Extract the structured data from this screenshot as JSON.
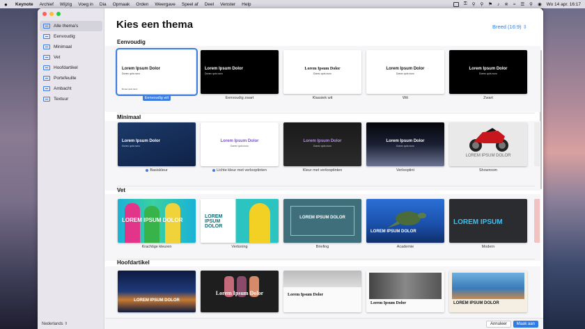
{
  "menubar": {
    "app": "Keynote",
    "items": [
      "Archief",
      "Wijzig",
      "Voeg in",
      "Dia",
      "Opmaak",
      "Orden",
      "Weergave",
      "Speel af",
      "Deel",
      "Venster",
      "Help"
    ],
    "datetime": "Wo 14 apr. 16:17"
  },
  "sidebar": {
    "items": [
      {
        "label": "Alle thema's"
      },
      {
        "label": "Eenvoudig"
      },
      {
        "label": "Minimaal"
      },
      {
        "label": "Vet"
      },
      {
        "label": "Hoofdartikel"
      },
      {
        "label": "Portefeuille"
      },
      {
        "label": "Ambacht"
      },
      {
        "label": "Textuur"
      }
    ],
    "language": "Nederlands ⇳"
  },
  "main": {
    "title": "Kies een thema",
    "aspect": "Breed (16:9) ⇳"
  },
  "sections": [
    {
      "title": "Eenvoudig",
      "themes": [
        {
          "label": "Eenvoudig wit",
          "title": "Lorem Ipsum Dolor",
          "sub": "Donec quis nunc",
          "footer": "Donec quis nunc"
        },
        {
          "label": "Eenvoudig zwart",
          "title": "Lorem Ipsum Dolor",
          "sub": "Donec quis nunc"
        },
        {
          "label": "Klassiek wit",
          "title": "Lorem Ipsum Dolor",
          "sub": "Donec quis nunc"
        },
        {
          "label": "Wit",
          "title": "Lorem Ipsum Dolor",
          "sub": "Donec quis nunc"
        },
        {
          "label": "Zwart",
          "title": "Lorem Ipsum Dolor",
          "sub": "Donec quis nunc"
        }
      ]
    },
    {
      "title": "Minimaal",
      "themes": [
        {
          "label": "Basiskleur",
          "title": "Lorem Ipsum Dolor",
          "sub": "Donec quis nunc"
        },
        {
          "label": "Lichte kleur met verlooptinten",
          "title": "Lorem Ipsum Dolor",
          "sub": "Donec quis nunc"
        },
        {
          "label": "Kleur met verlooptinten",
          "title": "Lorem Ipsum Dolor",
          "sub": "Donec quis nunc"
        },
        {
          "label": "Verlooptint",
          "title": "Lorem Ipsum Dolor",
          "sub": "Donec quis nunc"
        },
        {
          "label": "Showroom",
          "title": "LOREM IPSUM DOLOR",
          "sub": ""
        }
      ]
    },
    {
      "title": "Vet",
      "themes": [
        {
          "label": "Krachtige kleuren",
          "title": "LOREM IPSUM DOLOR"
        },
        {
          "label": "Vertoning",
          "title": "LOREM IPSUM DOLOR"
        },
        {
          "label": "Briefing",
          "title": "LOREM IPSUM DOLOR"
        },
        {
          "label": "Academie",
          "title": "LOREM IPSUM DOLOR"
        },
        {
          "label": "Modern",
          "title": "LOREM IPSUM"
        }
      ]
    },
    {
      "title": "Hoofdartikel",
      "themes": [
        {
          "title": "LOREM IPSUM DOLOR"
        },
        {
          "title": "Lorem Ipsum Dolor"
        },
        {
          "title": "Lorem Ipsum Dolor"
        },
        {
          "title": "Lorem Ipsum Dolor"
        },
        {
          "title": "LOREM IPSUM DOLOR"
        }
      ]
    }
  ],
  "footer": {
    "cancel": "Annuleer",
    "create": "Maak aan"
  }
}
